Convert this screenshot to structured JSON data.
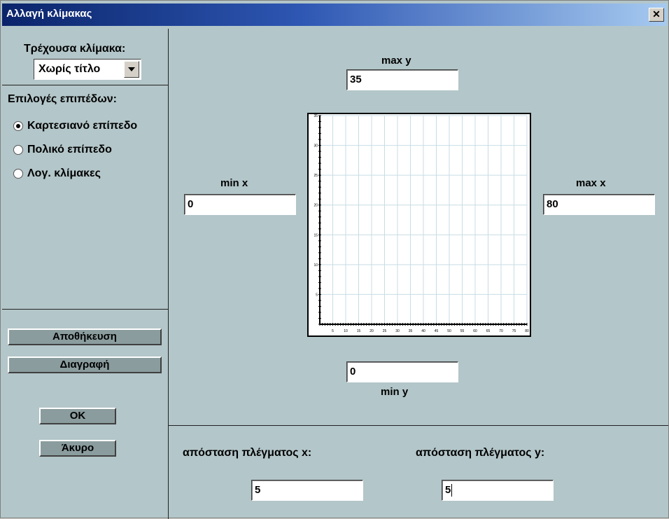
{
  "window": {
    "title": "Αλλαγή κλίμακας",
    "close_label": "✕"
  },
  "sidebar": {
    "current_scale_label": "Τρέχουσα κλίμακα:",
    "current_scale_value": "Χωρίς τίτλο",
    "plane_options_label": "Επιλογές επιπέδων:",
    "options": [
      {
        "label": "Καρτεσιανό επίπεδο",
        "selected": true
      },
      {
        "label": "Πολικό επίπεδο",
        "selected": false
      },
      {
        "label": "Λογ. κλίμακες",
        "selected": false
      }
    ],
    "save_label": "Αποθήκευση",
    "delete_label": "Διαγραφή",
    "ok_label": "OK",
    "cancel_label": "Άκυρο"
  },
  "fields": {
    "max_y_label": "max y",
    "max_y": "35",
    "min_x_label": "min x",
    "min_x": "0",
    "max_x_label": "max x",
    "max_x": "80",
    "min_y_label": "min y",
    "min_y": "0",
    "grid_x_label": "απόσταση πλέγματος x:",
    "grid_x": "5",
    "grid_y_label": "απόσταση πλέγματος y:",
    "grid_y": "5"
  },
  "preview": {
    "x_min": 0,
    "x_max": 80,
    "x_step": 5,
    "y_min": 0,
    "y_max": 35,
    "y_step": 5,
    "x_ticks": [
      "5",
      "10",
      "15",
      "20",
      "25",
      "30",
      "35",
      "40",
      "45",
      "50",
      "55",
      "60",
      "65",
      "70",
      "75",
      "80"
    ],
    "y_ticks": [
      "5",
      "10",
      "15",
      "20",
      "25",
      "30",
      "35"
    ]
  }
}
